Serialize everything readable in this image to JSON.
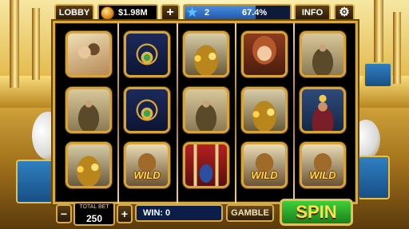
{
  "topbar": {
    "lobby_label": "LOBBY",
    "balance": "$1.98M",
    "add_label": "+",
    "level": "2",
    "level_progress": "67.4%",
    "level_progress_value": 67.4,
    "info_label": "INFO",
    "coin_icon": "coin-icon",
    "star_icon": "star-icon",
    "settings_icon": "gear-icon"
  },
  "reels": [
    [
      "couple",
      "warrior",
      "treasure"
    ],
    [
      "necklace",
      "necklace",
      "wild"
    ],
    [
      "treasure",
      "warrior",
      "temple"
    ],
    [
      "woman",
      "treasure",
      "wild"
    ],
    [
      "warrior",
      "king",
      "wild"
    ]
  ],
  "wild_label": "WILD",
  "bottombar": {
    "bet_minus": "−",
    "total_bet_label": "TOTAL BET",
    "total_bet": "250",
    "bet_plus": "+",
    "win_label": "WIN:",
    "win_value": "0",
    "gamble_label": "GAMBLE",
    "spin_label": "SPIN"
  },
  "colors": {
    "frame_gold": "#d9a93c",
    "spin_green": "#2aa62a",
    "level_blue": "#2f6fd0"
  }
}
